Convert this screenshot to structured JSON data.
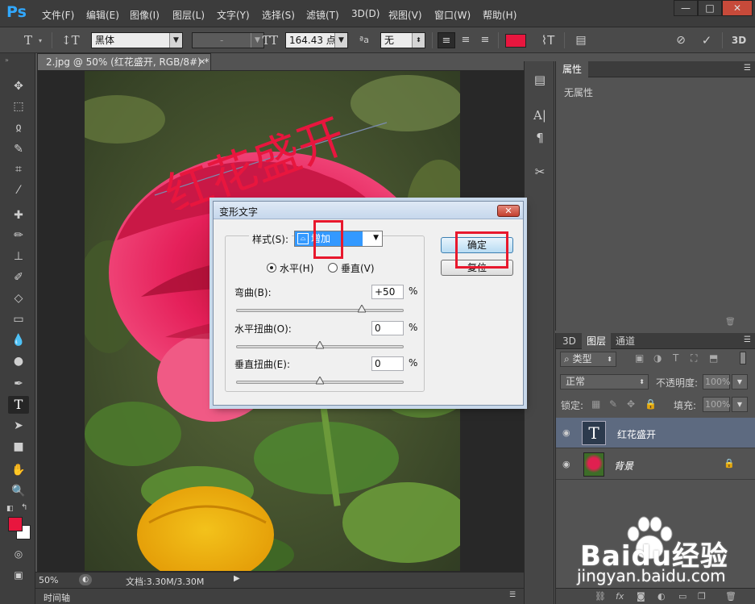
{
  "app": {
    "logo": "Ps",
    "menu": [
      "文件(F)",
      "编辑(E)",
      "图像(I)",
      "图层(L)",
      "文字(Y)",
      "选择(S)",
      "滤镜(T)",
      "3D(D)",
      "视图(V)",
      "窗口(W)",
      "帮助(H)"
    ],
    "window_buttons": {
      "minimize": "—",
      "maximize": "□",
      "close": "✕"
    }
  },
  "options_bar": {
    "font_family": "黑体",
    "font_style": "-",
    "font_size": "164.43 点",
    "aa_label": "ªa",
    "antialias": "无",
    "text_color": "#e8163e",
    "three_d": "3D"
  },
  "document": {
    "tab_title": "2.jpg @ 50% (红花盛开, RGB/8#) *",
    "warped_text": "红花盛开",
    "warped_text_color": "#e8163e",
    "zoom": "50%",
    "doc_size": "文档:3.30M/3.30M",
    "timeline": "时间轴"
  },
  "properties": {
    "tab": "属性",
    "empty": "无属性"
  },
  "layers_panel": {
    "tabs": [
      "3D",
      "图层",
      "通道"
    ],
    "filter_kind": "类型",
    "blend_mode": "正常",
    "opacity_label": "不透明度:",
    "opacity": "100%",
    "lock_label": "锁定:",
    "fill_label": "填充:",
    "fill": "100%",
    "layers": [
      {
        "name": "红花盛开",
        "thumb": "T",
        "selected": true
      },
      {
        "name": "背景",
        "thumb": "",
        "selected": false
      }
    ]
  },
  "dialog": {
    "title": "变形文字",
    "style_label": "样式(S):",
    "style_value": "增加",
    "orientation": {
      "horizontal": "水平(H)",
      "vertical": "垂直(V)",
      "selected": "horizontal"
    },
    "bend": {
      "label": "弯曲(B):",
      "value": "+50",
      "unit": "%",
      "level": 0.75
    },
    "h_distort": {
      "label": "水平扭曲(O):",
      "value": "0",
      "unit": "%",
      "level": 0.5
    },
    "v_distort": {
      "label": "垂直扭曲(E):",
      "value": "0",
      "unit": "%",
      "level": 0.5
    },
    "ok": "确定",
    "cancel": "复位"
  },
  "watermark": {
    "text": "Baidu经验",
    "url": "jingyan.baidu.com"
  },
  "colors": {
    "accent_red": "#e8182d",
    "foreground": "#e8163e",
    "background": "#ffffff"
  }
}
